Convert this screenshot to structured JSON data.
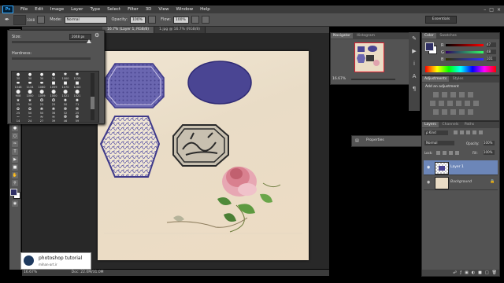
{
  "menubar": {
    "app_icon": "Ps",
    "items": [
      "File",
      "Edit",
      "Image",
      "Layer",
      "Type",
      "Select",
      "Filter",
      "3D",
      "View",
      "Window",
      "Help"
    ]
  },
  "options": {
    "brush_size": "1048",
    "mode_label": "Mode:",
    "mode_value": "Normal",
    "opacity_label": "Opacity:",
    "opacity_value": "100%",
    "flow_label": "Flow:",
    "flow_value": "100%",
    "workspace": "Essentials"
  },
  "tabs": [
    {
      "label": "16.7% (Layer 1, RGB/8)"
    },
    {
      "label": "1.jpg @ 16.7% (RGB/8)"
    }
  ],
  "brush_panel": {
    "size_label": "Size:",
    "size_value": "2048 px",
    "hardness_label": "Hardness:",
    "brushes": [
      {
        "n": "30"
      },
      {
        "n": "30"
      },
      {
        "n": "30"
      },
      {
        "n": "25"
      },
      {
        "n": "1000"
      },
      {
        "n": "1125"
      },
      {
        "n": "1048"
      },
      {
        "n": "1134"
      },
      {
        "n": "1060"
      },
      {
        "n": "1059"
      },
      {
        "n": "1070"
      },
      {
        "n": "1280"
      },
      {
        "n": "908"
      },
      {
        "n": "1000"
      },
      {
        "n": "1059"
      },
      {
        "n": "1000"
      },
      {
        "n": "1021"
      },
      {
        "n": "1021"
      },
      {
        "n": "25"
      },
      {
        "n": "50"
      },
      {
        "n": "25"
      },
      {
        "n": "25"
      },
      {
        "n": "50"
      },
      {
        "n": "71"
      },
      {
        "n": "25"
      },
      {
        "n": "50"
      },
      {
        "n": "50"
      },
      {
        "n": "36"
      },
      {
        "n": "32"
      },
      {
        "n": "25"
      },
      {
        "n": "14"
      },
      {
        "n": "24"
      },
      {
        "n": "27"
      },
      {
        "n": "39"
      },
      {
        "n": "46"
      },
      {
        "n": "59"
      }
    ]
  },
  "navigator": {
    "tabs": [
      "Navigator",
      "Histogram"
    ],
    "zoom": "16.67%"
  },
  "properties": {
    "label": "Properties"
  },
  "color_panel": {
    "tabs": [
      "Color",
      "Swatches"
    ],
    "r_label": "R",
    "r_value": "47",
    "g_label": "G",
    "g_value": "48",
    "b_label": "B",
    "b_value": "101",
    "fg_color": "#2f3065",
    "bg_color": "#ffffff"
  },
  "adjustments": {
    "tabs": [
      "Adjustments",
      "Styles"
    ],
    "title": "Add an adjustment"
  },
  "layers": {
    "tabs": [
      "Layers",
      "Channels",
      "Paths"
    ],
    "kind_label": "ρ Kind",
    "blend_mode": "Normal",
    "opacity_label": "Opacity:",
    "opacity_value": "100%",
    "lock_label": "Lock:",
    "fill_label": "Fill:",
    "fill_value": "100%",
    "items": [
      {
        "name": "Layer 1",
        "selected": true
      },
      {
        "name": "Background",
        "selected": false
      }
    ]
  },
  "status": {
    "zoom": "16.67%",
    "doc": "Doc: 22.0M/31.0M"
  },
  "watermark": {
    "title": "photoshop tutorial",
    "url": "mihan-art.ir"
  },
  "colors": {
    "stamp_purple": "#3f3a8a",
    "stamp_black": "#2a2a2a",
    "paper": "#eadcc5"
  }
}
